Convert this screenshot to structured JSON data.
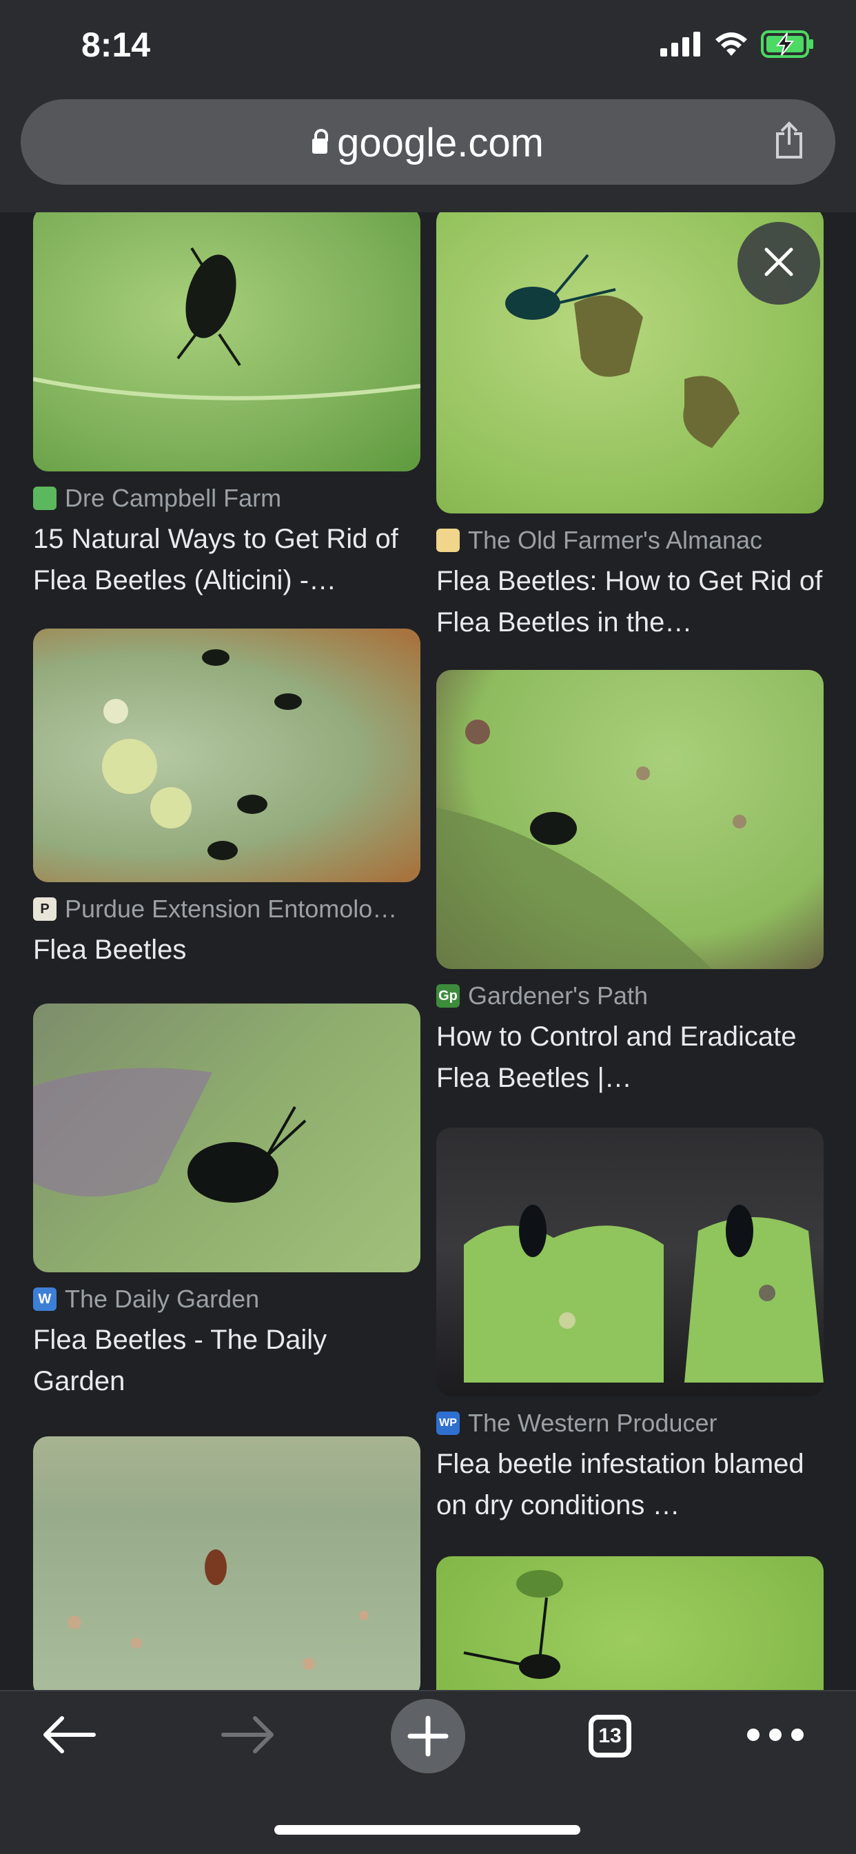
{
  "status_bar": {
    "time": "8:14"
  },
  "address_bar": {
    "url": "google.com"
  },
  "results": [
    {
      "source": "Dre Campbell Farm",
      "title": "15 Natural Ways to Get Rid of Flea Beetles (Alticini) -…",
      "favicon_color": "#5cb85c"
    },
    {
      "source": "The Old Farmer's Almanac",
      "title": "Flea Beetles: How to Get Rid of Flea Beetles in the…",
      "favicon_color": "#f0d58a"
    },
    {
      "source": "Purdue Extension Entomolo…",
      "title": "Flea Beetles",
      "favicon_color": "#e8e4d8"
    },
    {
      "source": "Gardener's Path",
      "title": "How to Control and Eradicate Flea Beetles |…",
      "favicon_color": "#3c8c3c",
      "favicon_text": "Gp"
    },
    {
      "source": "The Daily Garden",
      "title": "Flea Beetles - The Daily Garden",
      "favicon_color": "#3d7fd6",
      "favicon_text": "W"
    },
    {
      "source": "The Western Producer",
      "title": "Flea beetle infestation blamed on dry conditions …",
      "favicon_color": "#2f6fcf",
      "favicon_text": "WP"
    }
  ],
  "toolbar": {
    "tab_count": "13"
  }
}
